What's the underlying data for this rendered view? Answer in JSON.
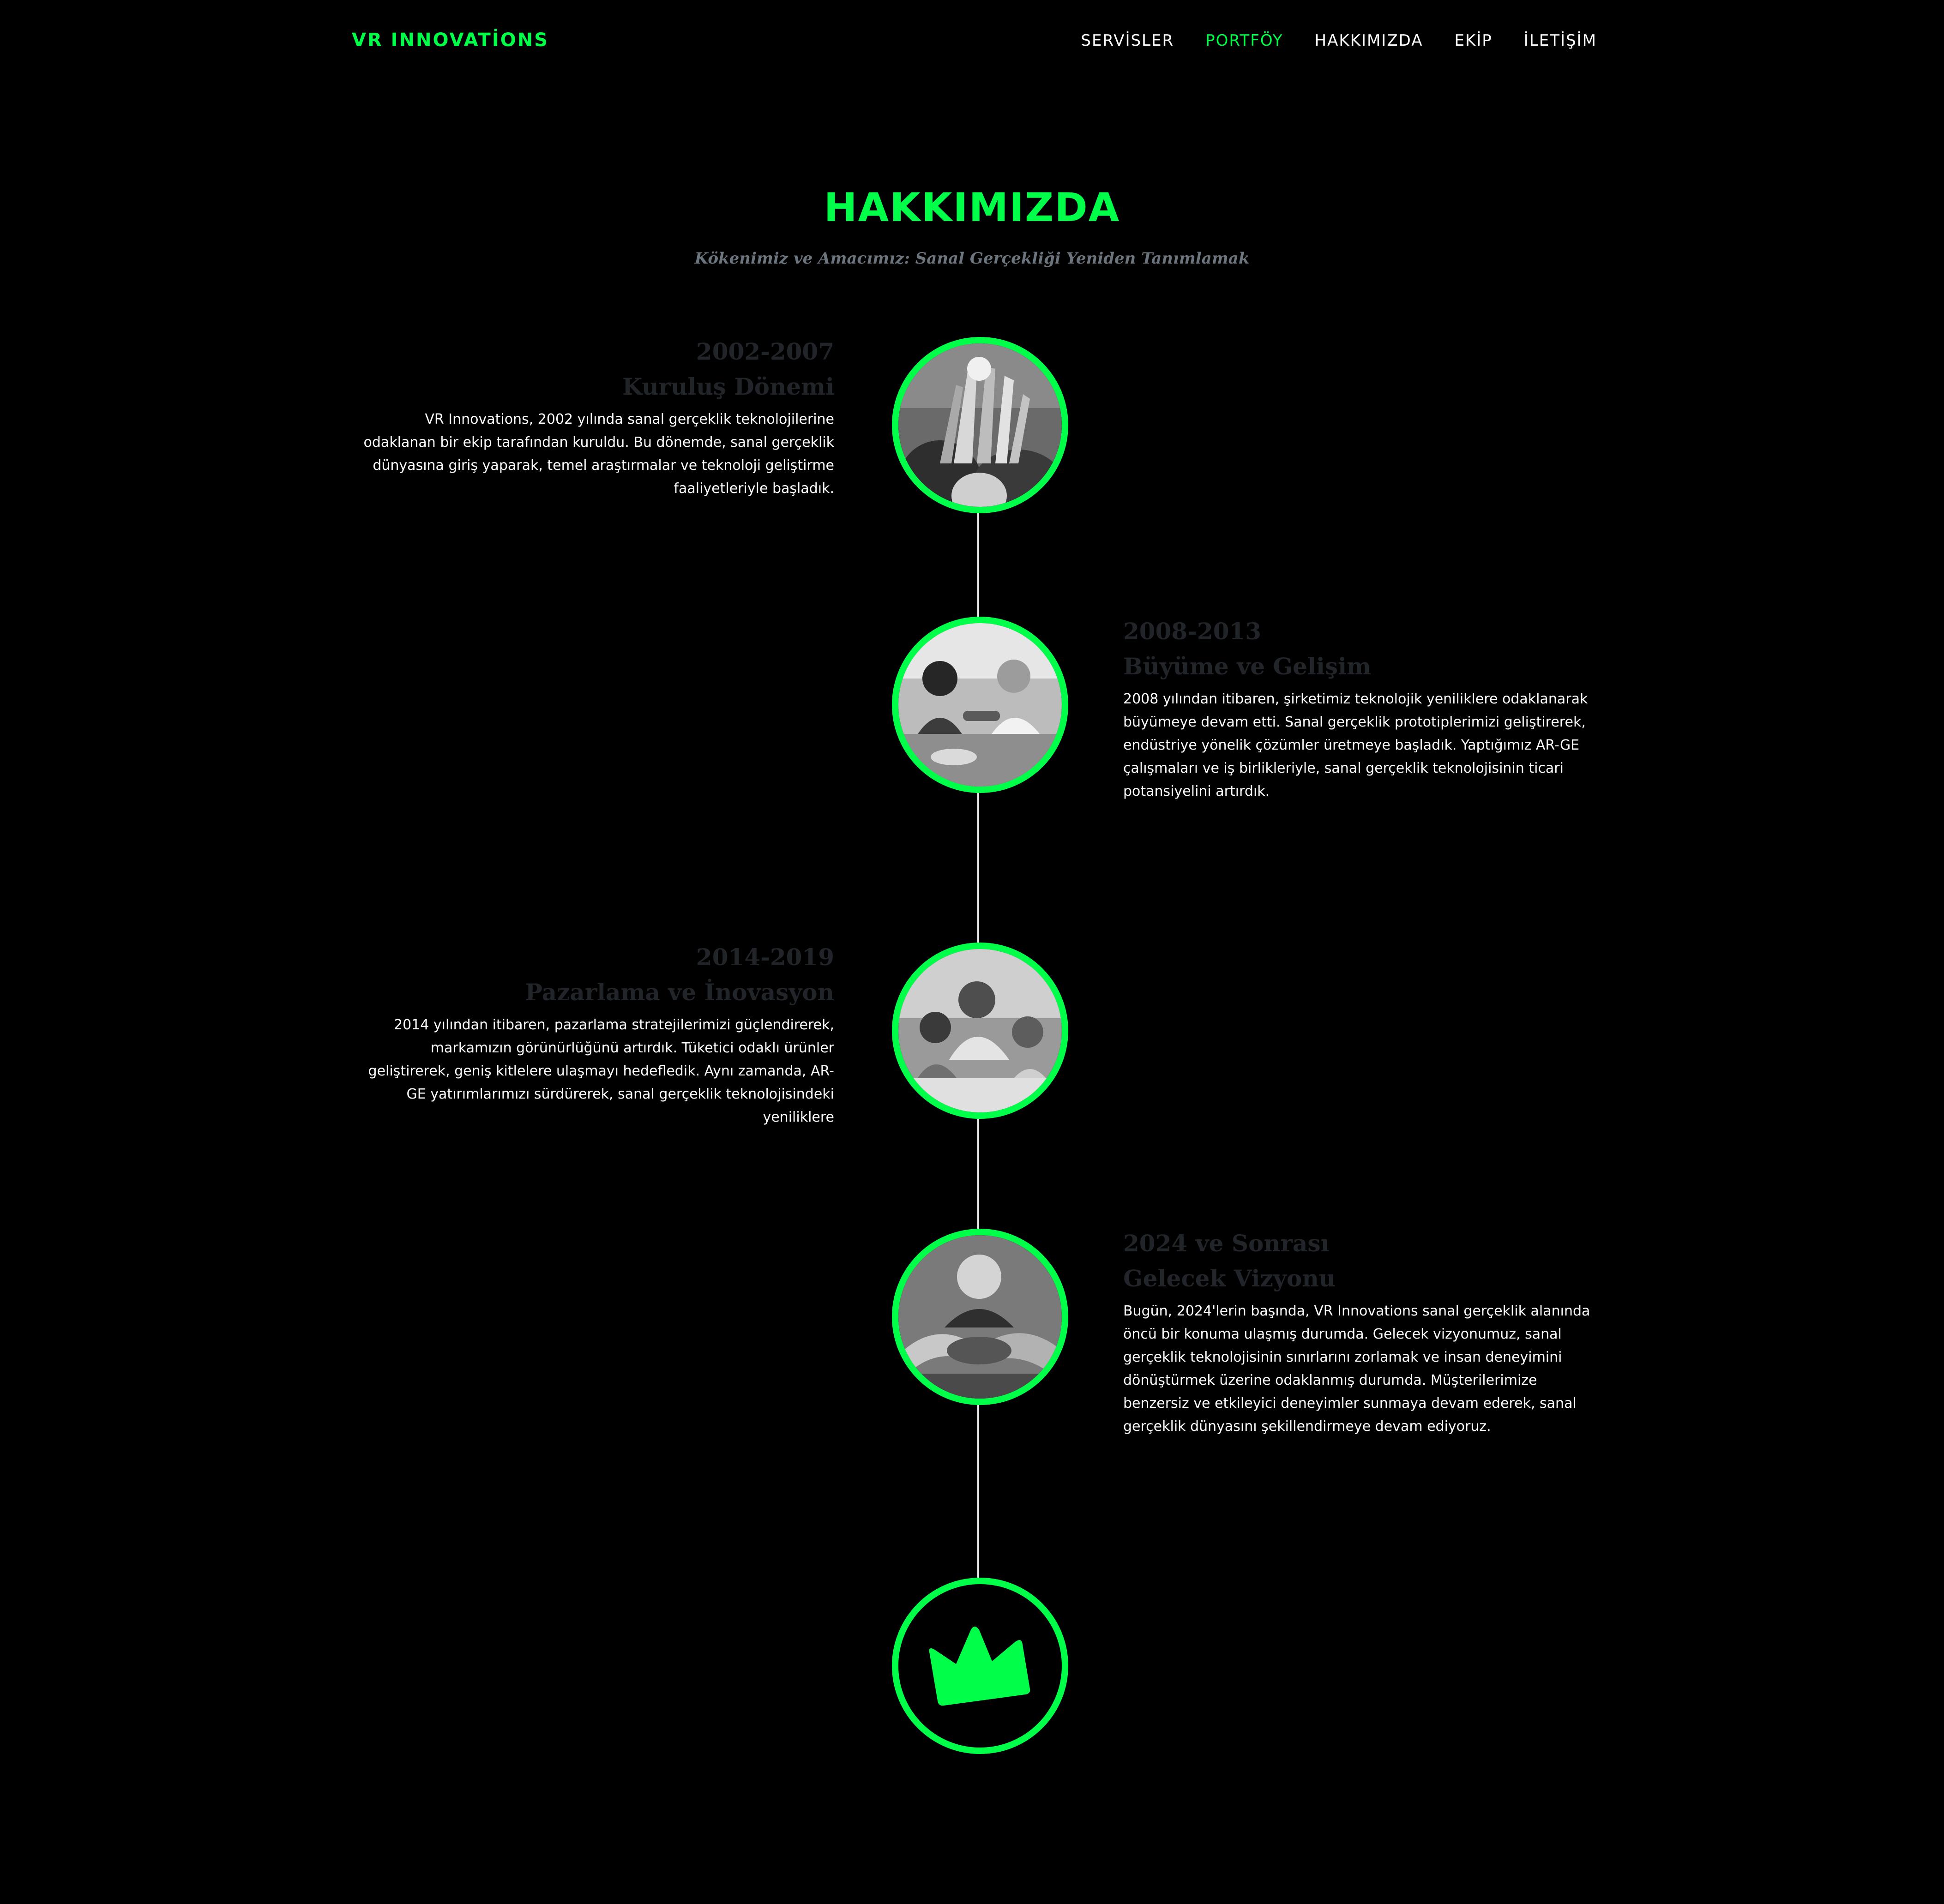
{
  "colors": {
    "accent": "#00ff48",
    "background": "#000000",
    "muted_heading": "#212529",
    "subheading": "#6c757d",
    "line": "#e9ecef"
  },
  "navbar": {
    "brand": "VR INNOVATİONS",
    "items": [
      {
        "label": "SERVİSLER",
        "active": false
      },
      {
        "label": "PORTFÖY",
        "active": true
      },
      {
        "label": "HAKKIMIZDA",
        "active": false
      },
      {
        "label": "EKİP",
        "active": false
      },
      {
        "label": "İLETİŞİM",
        "active": false
      }
    ]
  },
  "about": {
    "heading": "HAKKIMIZDA",
    "subheading": "Kökenimiz ve Amacımız: Sanal Gerçekliği Yeniden Tanımlamak"
  },
  "timeline": [
    {
      "year": "2002-2007",
      "title": "Kuruluş Dönemi",
      "body": "VR Innovations, 2002 yılında sanal gerçeklik teknolojilerine odaklanan bir ekip tarafından kuruldu. Bu dönemde, sanal gerçeklik dünyasına giriş yaparak, temel araştırmalar ve teknoloji geliştirme faaliyetleriyle başladık.",
      "image": "team-high-five-photo"
    },
    {
      "year": "2008-2013",
      "title": "Büyüme ve Gelişim",
      "body": "2008 yılından itibaren, şirketimiz teknolojik yeniliklere odaklanarak büyümeye devam etti. Sanal gerçeklik prototiplerimizi geliştirerek, endüstriye yönelik çözümler üretmeye başladık. Yaptığımız AR-GE çalışmaları ve iş birlikleriyle, sanal gerçeklik teknolojisinin ticari potansiyelini artırdık.",
      "image": "colleagues-handshake-photo"
    },
    {
      "year": "2014-2019",
      "title": "Pazarlama ve İnovasyon",
      "body": "2014 yılından itibaren, pazarlama stratejilerimizi güçlendirerek, markamızın görünürlüğünü artırdık. Tüketici odaklı ürünler geliştirerek, geniş kitlelere ulaşmayı hedefledik. Aynı zamanda, AR-GE yatırımlarımızı sürdürerek, sanal gerçeklik teknolojisindeki yeniliklere",
      "image": "team-collaboration-photo"
    },
    {
      "year": "2024 ve Sonrası",
      "title": "Gelecek Vizyonu",
      "body": "Bugün, 2024'lerin başında, VR Innovations sanal gerçeklik alanında öncü bir konuma ulaşmış durumda. Gelecek vizyonumuz, sanal gerçeklik teknolojisinin sınırlarını zorlamak ve insan deneyimini dönüştürmek üzerine odaklanmış durumda. Müşterilerimize benzersiz ve etkileyici deneyimler sunmaya devam ederek, sanal gerçeklik dünyasını şekillendirmeye devam ediyoruz.",
      "image": "hands-together-photo"
    }
  ],
  "timeline_end_icon": "crown-icon"
}
